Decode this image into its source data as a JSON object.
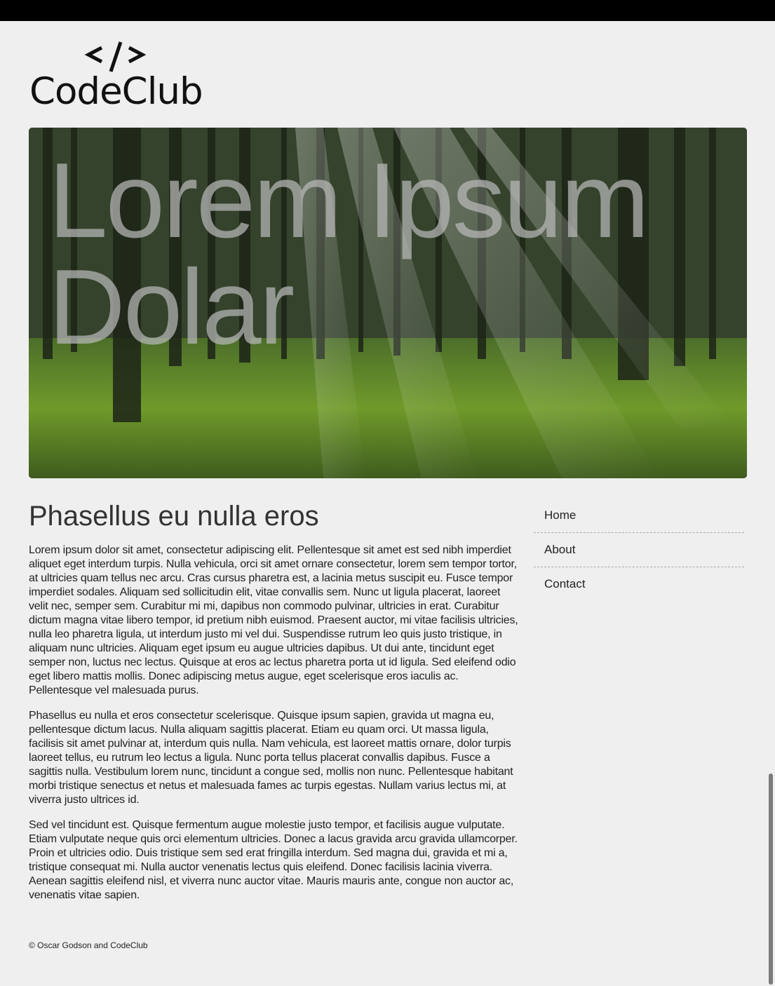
{
  "logo": {
    "tag": "</>",
    "text": "CodeClub"
  },
  "hero": {
    "heading": "Lorem Ipsum Dolar"
  },
  "main": {
    "title": "Phasellus eu nulla eros",
    "paragraphs": [
      "Lorem ipsum dolor sit amet, consectetur adipiscing elit. Pellentesque sit amet est sed nibh imperdiet aliquet eget interdum turpis. Nulla vehicula, orci sit amet ornare consectetur, lorem sem tempor tortor, at ultricies quam tellus nec arcu. Cras cursus pharetra est, a lacinia metus suscipit eu. Fusce tempor imperdiet sodales. Aliquam sed sollicitudin elit, vitae convallis sem. Nunc ut ligula placerat, laoreet velit nec, semper sem. Curabitur mi mi, dapibus non commodo pulvinar, ultricies in erat. Curabitur dictum magna vitae libero tempor, id pretium nibh euismod. Praesent auctor, mi vitae facilisis ultricies, nulla leo pharetra ligula, ut interdum justo mi vel dui. Suspendisse rutrum leo quis justo tristique, in aliquam nunc ultricies. Aliquam eget ipsum eu augue ultricies dapibus. Ut dui ante, tincidunt eget semper non, luctus nec lectus. Quisque at eros ac lectus pharetra porta ut id ligula. Sed eleifend odio eget libero mattis mollis. Donec adipiscing metus augue, eget scelerisque eros iaculis ac. Pellentesque vel malesuada purus.",
      "Phasellus eu nulla et eros consectetur scelerisque. Quisque ipsum sapien, gravida ut magna eu, pellentesque dictum lacus. Nulla aliquam sagittis placerat. Etiam eu quam orci. Ut massa ligula, facilisis sit amet pulvinar at, interdum quis nulla. Nam vehicula, est laoreet mattis ornare, dolor turpis laoreet tellus, eu rutrum leo lectus a ligula. Nunc porta tellus placerat convallis dapibus. Fusce a sagittis nulla. Vestibulum lorem nunc, tincidunt a congue sed, mollis non nunc. Pellentesque habitant morbi tristique senectus et netus et malesuada fames ac turpis egestas. Nullam varius lectus mi, at viverra justo ultrices id.",
      "Sed vel tincidunt est. Quisque fermentum augue molestie justo tempor, et facilisis augue vulputate. Etiam vulputate neque quis orci elementum ultricies. Donec a lacus gravida arcu gravida ullamcorper. Proin et ultricies odio. Duis tristique sem sed erat fringilla interdum. Sed magna dui, gravida et mi a, tristique consequat mi. Nulla auctor venenatis lectus quis eleifend. Donec facilisis lacinia viverra. Aenean sagittis eleifend nisl, et viverra nunc auctor vitae. Mauris mauris ante, congue non auctor ac, venenatis vitae sapien."
    ]
  },
  "nav": {
    "items": [
      "Home",
      "About",
      "Contact"
    ]
  },
  "footer": {
    "text": "© Oscar Godson and CodeClub"
  },
  "colors": {
    "background": "#efefef",
    "topbar": "#000000",
    "text": "#222222",
    "hero_heading": "#b9b9b9"
  }
}
